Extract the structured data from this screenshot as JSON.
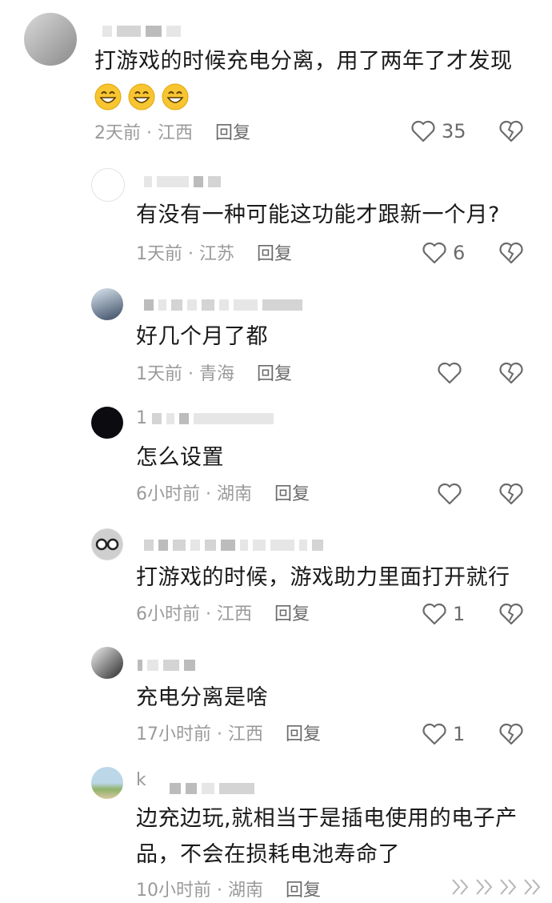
{
  "comments": [
    {
      "name": "",
      "text": "打游戏的时候充电分离，用了两年了才发现",
      "time": "2天前 · 江西",
      "reply": "回复",
      "likes": "35",
      "emoji": "grinning-face-icon"
    },
    {
      "name": "",
      "text": "有没有一种可能这功能才跟新一个月?",
      "time": "1天前 · 江苏",
      "reply": "回复",
      "likes": "6"
    },
    {
      "name": "",
      "text": "好几个月了都",
      "time": "1天前 · 青海",
      "reply": "回复",
      "likes": ""
    },
    {
      "name": "1",
      "text": "怎么设置",
      "time": "6小时前 · 湖南",
      "reply": "回复",
      "likes": ""
    },
    {
      "name": "",
      "text": "打游戏的时候，游戏助力里面打开就行",
      "time": "6小时前 · 江西",
      "reply": "回复",
      "likes": "1"
    },
    {
      "name": "",
      "text": "充电分离是啥",
      "time": "17小时前 · 江西",
      "reply": "回复",
      "likes": "1"
    },
    {
      "name": "k",
      "text_line1": "边充边玩,就相当于是插电使用的电子产",
      "text_line2": "品，不会在损耗电池寿命了",
      "time": "10小时前 · 湖南",
      "reply": "回复",
      "likes": ""
    }
  ],
  "colors": {
    "text": "#1a1a1a",
    "meta": "#9a9a9a",
    "icon": "#6b6b6b"
  }
}
